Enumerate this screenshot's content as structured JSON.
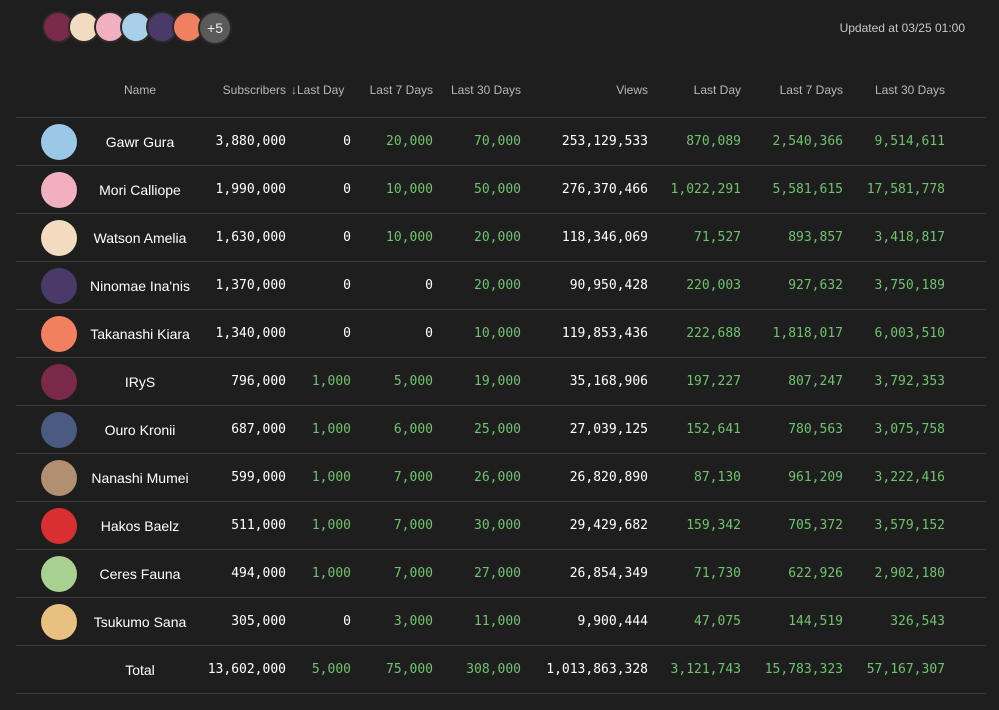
{
  "header": {
    "more_count": "+5",
    "updated": "Updated at 03/25 01:00",
    "avatar_colors": [
      "#7a2a48",
      "#f2dcc0",
      "#f0b0c0",
      "#a8d0e8",
      "#4a3a6a",
      "#f08060"
    ]
  },
  "columns": {
    "name": "Name",
    "subscribers": "Subscribers",
    "sort_icon": "↓",
    "sub_last_day": "Last Day",
    "sub_last_7": "Last 7 Days",
    "sub_last_30": "Last 30 Days",
    "views": "Views",
    "views_last_day": "Last Day",
    "views_last_7": "Last 7 Days",
    "views_last_30": "Last 30 Days"
  },
  "rows": [
    {
      "name": "Gawr Gura",
      "color": "#9cc8e8",
      "subs": "3,880,000",
      "d1": "0",
      "d7": "20,000",
      "d30": "70,000",
      "views": "253,129,533",
      "v1": "870,089",
      "v7": "2,540,366",
      "v30": "9,514,611"
    },
    {
      "name": "Mori Calliope",
      "color": "#f0b0c0",
      "subs": "1,990,000",
      "d1": "0",
      "d7": "10,000",
      "d30": "50,000",
      "views": "276,370,466",
      "v1": "1,022,291",
      "v7": "5,581,615",
      "v30": "17,581,778"
    },
    {
      "name": "Watson Amelia",
      "color": "#f2dcc0",
      "subs": "1,630,000",
      "d1": "0",
      "d7": "10,000",
      "d30": "20,000",
      "views": "118,346,069",
      "v1": "71,527",
      "v7": "893,857",
      "v30": "3,418,817"
    },
    {
      "name": "Ninomae Ina'nis",
      "color": "#4a3a6a",
      "subs": "1,370,000",
      "d1": "0",
      "d7": "0",
      "d30": "20,000",
      "views": "90,950,428",
      "v1": "220,003",
      "v7": "927,632",
      "v30": "3,750,189"
    },
    {
      "name": "Takanashi Kiara",
      "color": "#f08060",
      "subs": "1,340,000",
      "d1": "0",
      "d7": "0",
      "d30": "10,000",
      "views": "119,853,436",
      "v1": "222,688",
      "v7": "1,818,017",
      "v30": "6,003,510"
    },
    {
      "name": "IRyS",
      "color": "#7a2a48",
      "subs": "796,000",
      "d1": "1,000",
      "d7": "5,000",
      "d30": "19,000",
      "views": "35,168,906",
      "v1": "197,227",
      "v7": "807,247",
      "v30": "3,792,353"
    },
    {
      "name": "Ouro Kronii",
      "color": "#4a5a80",
      "subs": "687,000",
      "d1": "1,000",
      "d7": "6,000",
      "d30": "25,000",
      "views": "27,039,125",
      "v1": "152,641",
      "v7": "780,563",
      "v30": "3,075,758"
    },
    {
      "name": "Nanashi Mumei",
      "color": "#b09070",
      "subs": "599,000",
      "d1": "1,000",
      "d7": "7,000",
      "d30": "26,000",
      "views": "26,820,890",
      "v1": "87,130",
      "v7": "961,209",
      "v30": "3,222,416"
    },
    {
      "name": "Hakos Baelz",
      "color": "#d83030",
      "subs": "511,000",
      "d1": "1,000",
      "d7": "7,000",
      "d30": "30,000",
      "views": "29,429,682",
      "v1": "159,342",
      "v7": "705,372",
      "v30": "3,579,152"
    },
    {
      "name": "Ceres Fauna",
      "color": "#a8d090",
      "subs": "494,000",
      "d1": "1,000",
      "d7": "7,000",
      "d30": "27,000",
      "views": "26,854,349",
      "v1": "71,730",
      "v7": "622,926",
      "v30": "2,902,180"
    },
    {
      "name": "Tsukumo Sana",
      "color": "#e8c080",
      "subs": "305,000",
      "d1": "0",
      "d7": "3,000",
      "d30": "11,000",
      "views": "9,900,444",
      "v1": "47,075",
      "v7": "144,519",
      "v30": "326,543"
    }
  ],
  "total": {
    "name": "Total",
    "subs": "13,602,000",
    "d1": "5,000",
    "d7": "75,000",
    "d30": "308,000",
    "views": "1,013,863,328",
    "v1": "3,121,743",
    "v7": "15,783,323",
    "v30": "57,167,307"
  }
}
